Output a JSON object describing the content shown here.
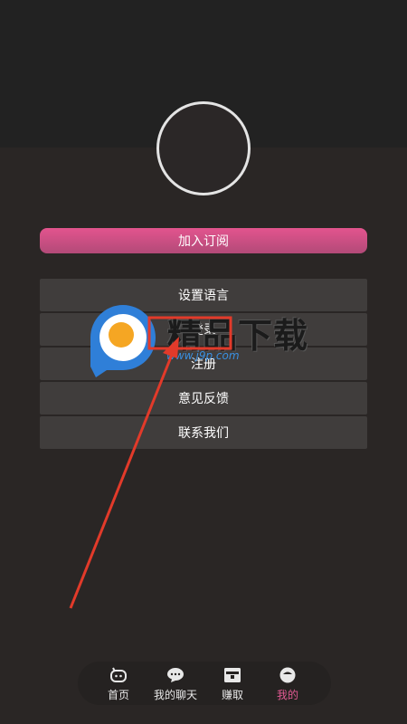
{
  "profile": {
    "subscribe_label": "加入订阅"
  },
  "menu": {
    "items": [
      {
        "label": "设置语言"
      },
      {
        "label": "登录"
      },
      {
        "label": "注册"
      },
      {
        "label": "意见反馈"
      },
      {
        "label": "联系我们"
      }
    ]
  },
  "watermark": {
    "text": "精品下载",
    "url": "www.j9p.com"
  },
  "bottom_nav": {
    "items": [
      {
        "label": "首页",
        "icon": "home-icon"
      },
      {
        "label": "我的聊天",
        "icon": "chat-bubble-icon"
      },
      {
        "label": "赚取",
        "icon": "earn-box-icon"
      },
      {
        "label": "我的",
        "icon": "profile-face-icon",
        "active": true
      }
    ]
  },
  "colors": {
    "background": "#2a2625",
    "header": "#222222",
    "accent": "#e25a93",
    "annotation": "#e23a2a"
  }
}
